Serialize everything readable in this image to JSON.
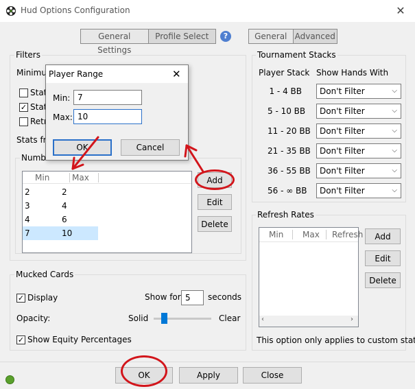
{
  "window": {
    "title": "Hud Options Configuration",
    "close_glyph": "✕"
  },
  "top_tabs_left": [
    "General Settings",
    "Profile Select"
  ],
  "top_tabs_right": [
    "General",
    "Advanced"
  ],
  "help_glyph": "?",
  "filters": {
    "label": "Filters",
    "minimum_partial": "Minimu",
    "checks": [
      {
        "label": "Stats",
        "checked": false
      },
      {
        "label": "Stats",
        "checked": true
      },
      {
        "label": "Retr",
        "checked": false
      }
    ],
    "stats_from_partial": "Stats fro",
    "number_partial": "Numb",
    "table_columns": [
      "Min",
      "Max"
    ],
    "rows": [
      {
        "min": "2",
        "max": "2"
      },
      {
        "min": "3",
        "max": "4"
      },
      {
        "min": "4",
        "max": "6"
      },
      {
        "min": "7",
        "max": "10"
      }
    ],
    "buttons": {
      "add": "Add",
      "edit": "Edit",
      "delete": "Delete"
    }
  },
  "dialog": {
    "title": "Player Range",
    "close_glyph": "✕",
    "min_label": "Min:",
    "min_value": "7",
    "max_label": "Max:",
    "max_value": "10",
    "ok": "OK",
    "cancel": "Cancel"
  },
  "tournament": {
    "label": "Tournament Stacks",
    "col_stack": "Player Stack",
    "col_hands": "Show Hands With",
    "rows": [
      {
        "stack": "1 - 4 BB",
        "filter": "Don't Filter"
      },
      {
        "stack": "5 - 10 BB",
        "filter": "Don't Filter"
      },
      {
        "stack": "11 - 20 BB",
        "filter": "Don't Filter"
      },
      {
        "stack": "21 - 35 BB",
        "filter": "Don't Filter"
      },
      {
        "stack": "36 - 55 BB",
        "filter": "Don't Filter"
      },
      {
        "stack": "56 - ∞ BB",
        "filter": "Don't Filter"
      }
    ]
  },
  "refresh": {
    "label": "Refresh Rates",
    "columns": [
      "Min",
      "Max",
      "Refresh"
    ],
    "buttons": {
      "add": "Add",
      "edit": "Edit",
      "delete": "Delete"
    },
    "note": "This option only applies to custom stats."
  },
  "mucked": {
    "label": "Mucked Cards",
    "display_label": "Display",
    "display_checked": true,
    "show_for_label": "Show for",
    "show_for_value": "5",
    "seconds_label": "seconds",
    "opacity_label": "Opacity:",
    "solid_label": "Solid",
    "clear_label": "Clear",
    "opacity_level": 0.18,
    "equity_label": "Show Equity Percentages",
    "equity_checked": true
  },
  "footer": {
    "ok": "OK",
    "apply": "Apply",
    "close": "Close"
  },
  "colors": {
    "annotation_red": "#d2151b",
    "focus_blue": "#2a70c9"
  },
  "icons": [
    "app-logo-icon",
    "help-icon",
    "status-icon",
    "chevron-down-icon",
    "scroll-left-icon",
    "scroll-right-icon"
  ]
}
